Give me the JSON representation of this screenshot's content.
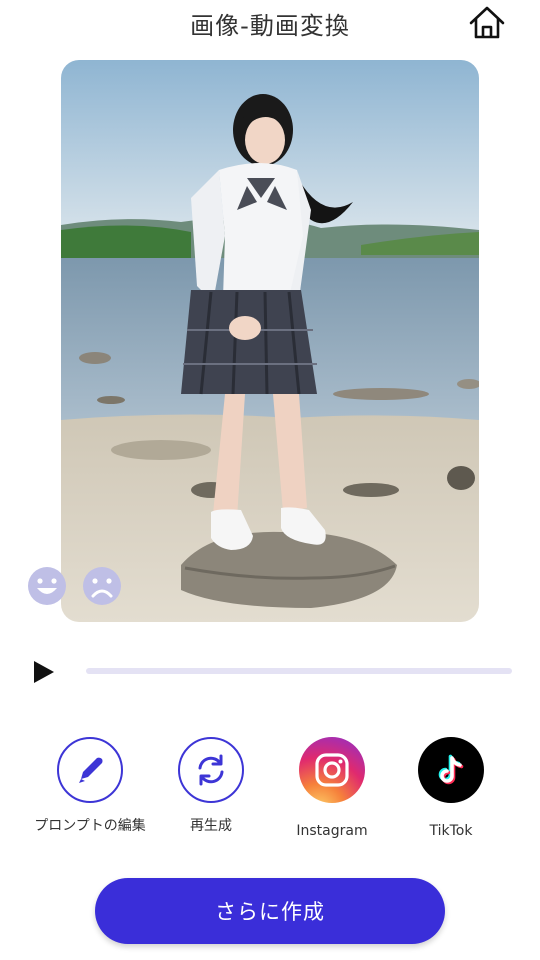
{
  "header": {
    "title": "画像-動画変換",
    "home_icon": "home-icon"
  },
  "media": {
    "type": "generated-image-preview",
    "subject": "girl-in-school-uniform-by-lake"
  },
  "rating": {
    "good_icon": "smile-icon",
    "bad_icon": "frown-icon"
  },
  "player": {
    "play_icon": "play-icon",
    "progress": 0.0
  },
  "actions": [
    {
      "label": "プロンプトの編集",
      "icon": "pen-icon"
    },
    {
      "label": "再生成",
      "icon": "refresh-icon"
    },
    {
      "label": "Instagram",
      "icon": "instagram-icon"
    },
    {
      "label": "TikTok",
      "icon": "tiktok-icon"
    }
  ],
  "create_button": {
    "label": "さらに作成"
  },
  "colors": {
    "accent": "#3a2ed9",
    "progress_track": "#e4e2f4",
    "rating_icon": "#bfbfe6"
  }
}
